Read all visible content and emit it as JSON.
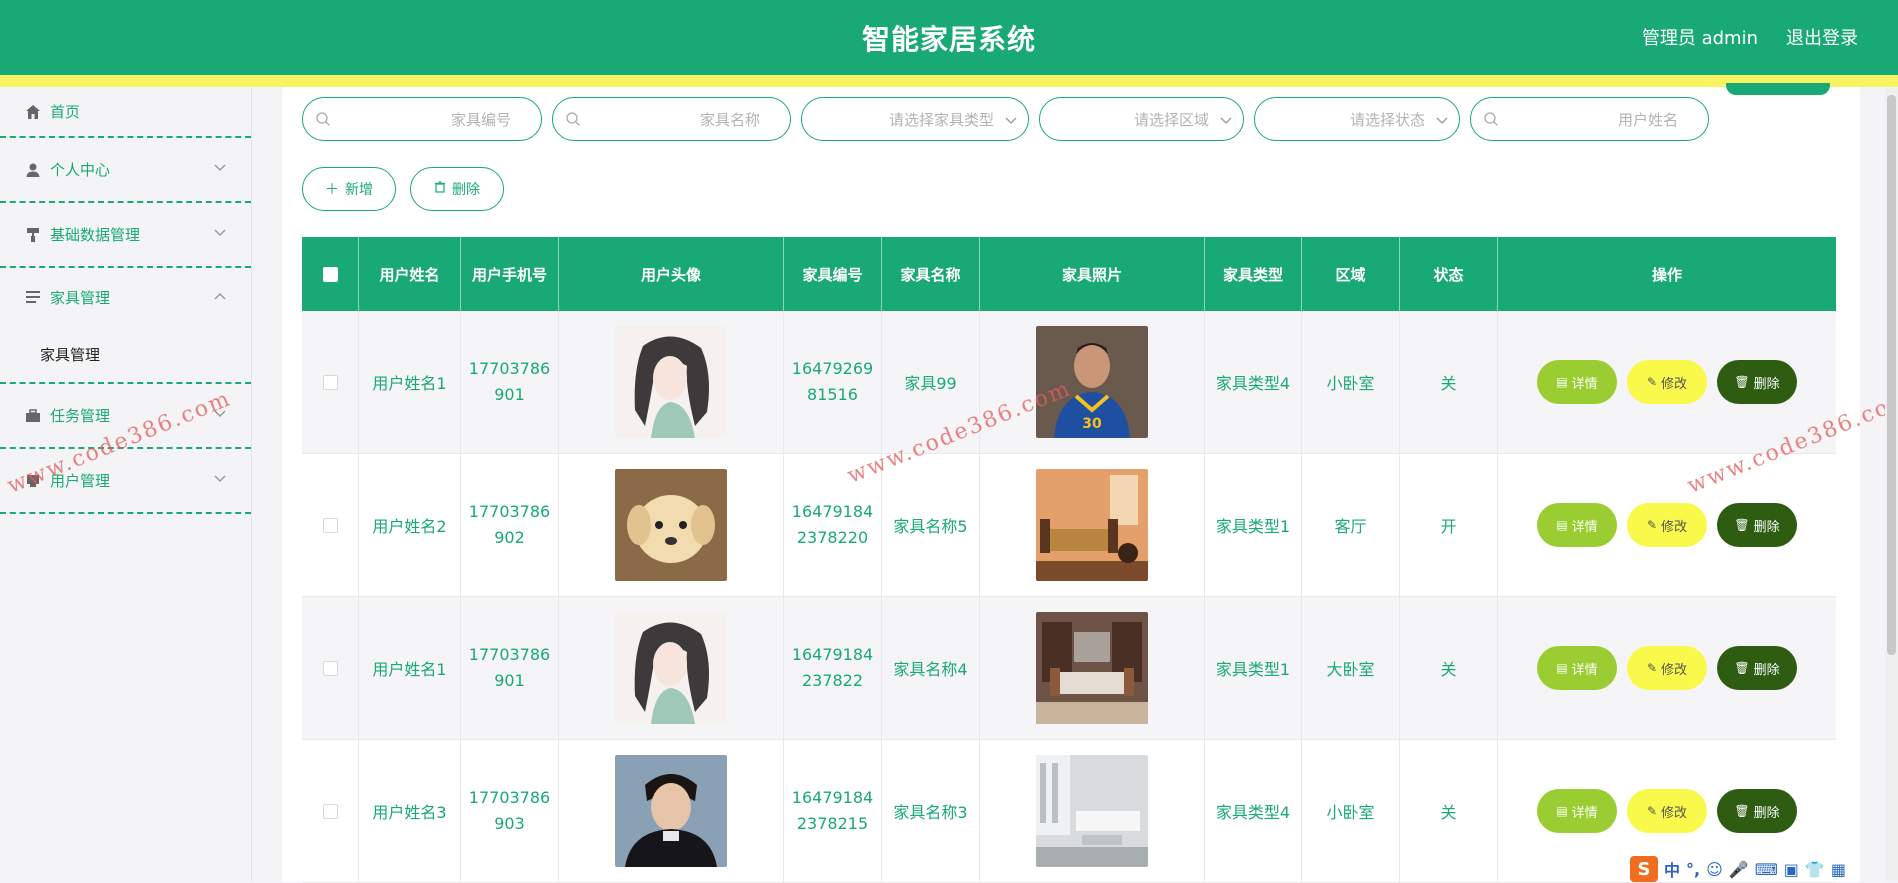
{
  "header": {
    "title": "智能家居系统",
    "user_label": "管理员 admin",
    "logout_label": "退出登录"
  },
  "sidebar": {
    "items": [
      {
        "label": "首页",
        "icon": "home-icon"
      },
      {
        "label": "个人中心",
        "icon": "user-icon"
      },
      {
        "label": "基础数据管理",
        "icon": "paint-roller-icon"
      },
      {
        "label": "家具管理",
        "icon": "list-icon",
        "expanded": true,
        "children": [
          {
            "label": "家具管理"
          }
        ]
      },
      {
        "label": "任务管理",
        "icon": "briefcase-icon"
      },
      {
        "label": "用户管理",
        "icon": "user-card-icon"
      }
    ]
  },
  "search": {
    "fields": [
      {
        "placeholder": "家具编号",
        "type": "input"
      },
      {
        "placeholder": "家具名称",
        "type": "input"
      },
      {
        "placeholder": "请选择家具类型",
        "type": "select"
      },
      {
        "placeholder": "请选择区域",
        "type": "select"
      },
      {
        "placeholder": "请选择状态",
        "type": "select"
      },
      {
        "placeholder": "用户姓名",
        "type": "input"
      }
    ]
  },
  "actions": {
    "add_label": "新增",
    "delete_label": "删除"
  },
  "table": {
    "headers": [
      "用户姓名",
      "用户手机号",
      "用户头像",
      "家具编号",
      "家具名称",
      "家具照片",
      "家具类型",
      "区域",
      "状态",
      "操作"
    ],
    "rows": [
      {
        "name": "用户姓名1",
        "phone1": "17703786",
        "phone2": "901",
        "avatar": "anime-girl-avatar",
        "code1": "16479269",
        "code2": "81516",
        "fname": "家具99",
        "photo": "basketball-player-photo",
        "type": "家具类型4",
        "area": "小卧室",
        "status": "关"
      },
      {
        "name": "用户姓名2",
        "phone1": "17703786",
        "phone2": "902",
        "avatar": "puppy-avatar",
        "code1": "16479184",
        "code2": "2378220",
        "fname": "家具名称5",
        "photo": "sofa-room-photo",
        "type": "家具类型1",
        "area": "客厅",
        "status": "开"
      },
      {
        "name": "用户姓名1",
        "phone1": "17703786",
        "phone2": "901",
        "avatar": "anime-girl-avatar",
        "code1": "16479184",
        "code2": "237822",
        "fname": "家具名称4",
        "photo": "living-room-photo",
        "type": "家具类型1",
        "area": "大卧室",
        "status": "关"
      },
      {
        "name": "用户姓名3",
        "phone1": "17703786",
        "phone2": "903",
        "avatar": "young-man-avatar",
        "code1": "16479184",
        "code2": "2378215",
        "fname": "家具名称3",
        "photo": "white-sofa-photo",
        "type": "家具类型4",
        "area": "小卧室",
        "status": "关"
      }
    ],
    "row_buttons": {
      "detail": "详情",
      "edit": "修改",
      "delete": "删除"
    }
  },
  "watermarks": [
    "www.code386.com",
    "www.code386.com",
    "www.code386.com"
  ],
  "ime": {
    "logo": "S",
    "lang": "中"
  },
  "colors": {
    "primary": "#19a974",
    "accent_yellow": "#f7f361",
    "detail_btn": "#9acd32",
    "edit_btn": "#f9f94b",
    "delete_btn": "#2e5d12"
  }
}
